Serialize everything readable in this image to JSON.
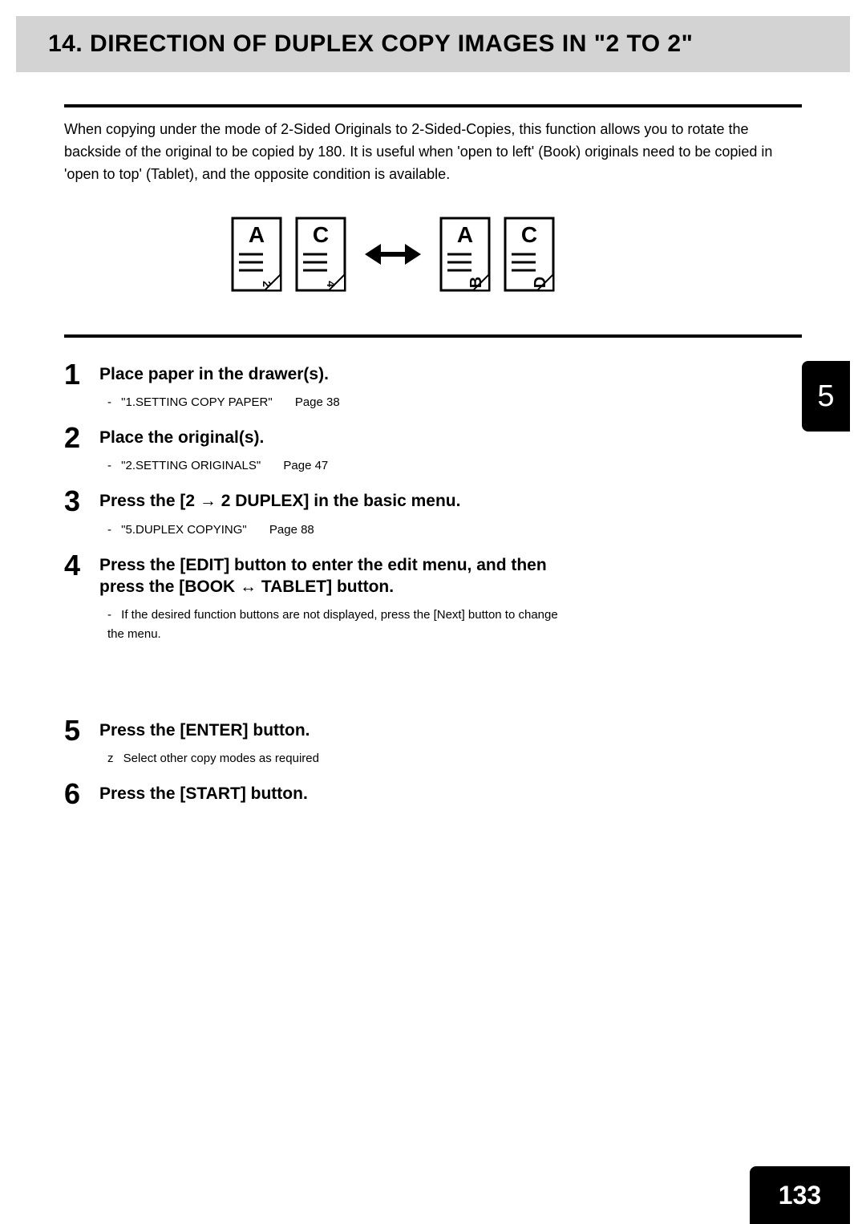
{
  "header": {
    "title": "14. DIRECTION OF DUPLEX COPY IMAGES IN \"2 TO 2\""
  },
  "intro": "When copying under the mode of 2-Sided Originals to 2-Sided-Copies, this function allows you to rotate the backside of the original to be copied by 180. It is useful when 'open to left' (Book) originals need to be copied in 'open to top' (Tablet), and the opposite condition is available.",
  "diagram": {
    "left_pair": {
      "front": "A",
      "back_rotated": "2",
      "front2": "C",
      "back2_rotated": "4"
    },
    "right_pair": {
      "front": "A",
      "back": "B",
      "front2": "C",
      "back2": "D"
    },
    "arrow": "↔"
  },
  "steps": [
    {
      "num": "1",
      "title": "Place paper in the drawer(s).",
      "subs": [
        {
          "dash": "-",
          "ref": "\"1.SETTING COPY PAPER\"",
          "pg": "Page 38"
        }
      ]
    },
    {
      "num": "2",
      "title": "Place the original(s).",
      "subs": [
        {
          "dash": "-",
          "ref": "\"2.SETTING ORIGINALS\"",
          "pg": "Page 47"
        }
      ]
    },
    {
      "num": "3",
      "title": "Press the [2 → 2 DUPLEX] in the basic menu.",
      "subs": [
        {
          "dash": "-",
          "ref": "\"5.DUPLEX COPYING\"",
          "pg": "Page 88"
        }
      ]
    },
    {
      "num": "4",
      "title": "Press the [EDIT] button to enter the edit menu, and then press the [BOOK ↔ TABLET] button.",
      "subs": [
        {
          "dash": "-",
          "ref": "If the desired function buttons are not displayed, press the [Next] button to change the menu.",
          "pg": ""
        }
      ]
    },
    {
      "num": "5",
      "title": "Press the [ENTER] button.",
      "subs": [
        {
          "dash": "z",
          "ref": "Select other copy modes as required",
          "pg": ""
        }
      ]
    },
    {
      "num": "6",
      "title": "Press the [START] button.",
      "subs": []
    }
  ],
  "chapter_tab": "5",
  "page_number": "133"
}
